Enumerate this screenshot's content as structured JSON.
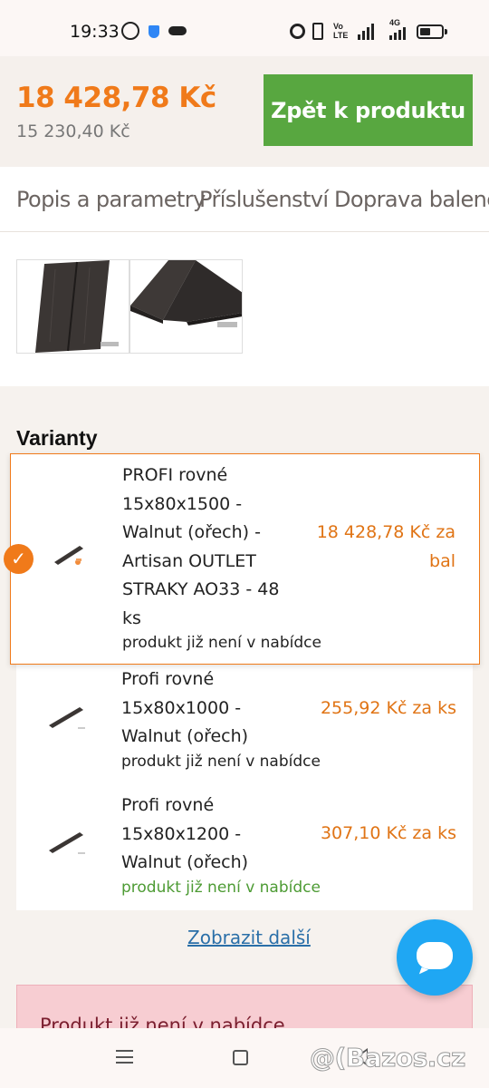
{
  "status_bar": {
    "time": "19:33",
    "volte": "Vo LTE",
    "network": "4G"
  },
  "header": {
    "price": "18 428,78 Kč",
    "price_excl_vat": "15 230,40 Kč",
    "back_button": "Zpět k produktu"
  },
  "tabs": [
    {
      "label": "Popis a parametry"
    },
    {
      "label": "Příslušenství"
    },
    {
      "label": "Doprava balené pl"
    }
  ],
  "variants": {
    "title": "Varianty",
    "items": [
      {
        "name_lines": [
          "PROFI rovné",
          "15x80x1500 -",
          "Walnut (ořech) -",
          "Artisan OUTLET",
          "STRAKY AO33 - 48",
          "ks"
        ],
        "status": "produkt již není v nabídce",
        "price_lines": [
          "18 428,78 Kč za",
          "bal"
        ],
        "selected": true
      },
      {
        "name_lines": [
          "Profi rovné",
          "15x80x1000 -",
          "Walnut (ořech)"
        ],
        "status": "produkt již není v nabídce",
        "price_lines": [
          "255,92 Kč za ks"
        ],
        "selected": false
      },
      {
        "name_lines": [
          "Profi rovné",
          "15x80x1200 -",
          "Walnut (ořech)"
        ],
        "status": "produkt již není v nabídce",
        "price_lines": [
          "307,10 Kč za ks"
        ],
        "selected": false
      }
    ],
    "show_more": "Zobrazit další"
  },
  "notice": {
    "text": "Produkt již není v nabídce"
  },
  "watermark": "@(Bazos.cz",
  "colors": {
    "accent_orange": "#f07a1a",
    "button_green": "#58a740",
    "status_green": "#4d9b34",
    "chat_blue": "#1fa7f3",
    "notice_pink": "#f7cdd2"
  }
}
